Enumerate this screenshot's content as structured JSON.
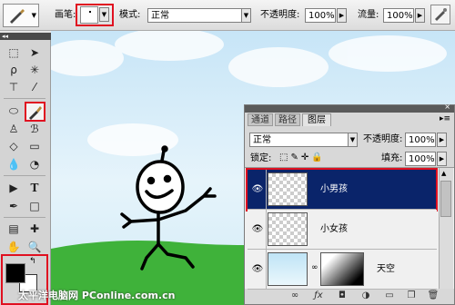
{
  "options_bar": {
    "brush_label": "画笔:",
    "mode_label": "模式:",
    "mode_value": "正常",
    "opacity_label": "不透明度:",
    "opacity_value": "100%",
    "flow_label": "流量:",
    "flow_value": "100%"
  },
  "toolbox": {
    "header": "◂◂",
    "tools": [
      "marquee-icon",
      "move-icon",
      "lasso-icon",
      "magic-wand-icon",
      "crop-icon",
      "eyedropper-icon",
      "healing-icon",
      "brush-icon",
      "stamp-icon",
      "history-brush-icon",
      "eraser-icon",
      "gradient-icon",
      "blur-icon",
      "dodge-icon",
      "path-select-icon",
      "type-icon",
      "pen-icon",
      "shape-icon",
      "notes-icon",
      "zoom-icon",
      "hand-icon"
    ],
    "foreground_color": "#000000",
    "background_color": "#ffffff"
  },
  "layers_panel": {
    "tabs": [
      "通道",
      "路径",
      "图层"
    ],
    "active_tab": "图层",
    "blend_mode": "正常",
    "opacity_label": "不透明度:",
    "opacity_value": "100%",
    "lock_label": "锁定:",
    "fill_label": "填充:",
    "fill_value": "100%",
    "layers": [
      {
        "name": "小男孩",
        "selected": true
      },
      {
        "name": "小女孩",
        "selected": false
      },
      {
        "name": "天空",
        "selected": false
      }
    ]
  },
  "watermark": "太平洋电脑网 PConline.com.cn",
  "colors": {
    "highlight_red": "#e01020",
    "selected_layer": "#0a246a",
    "sky": "#cfe9f7",
    "grass": "#3fb23a"
  }
}
